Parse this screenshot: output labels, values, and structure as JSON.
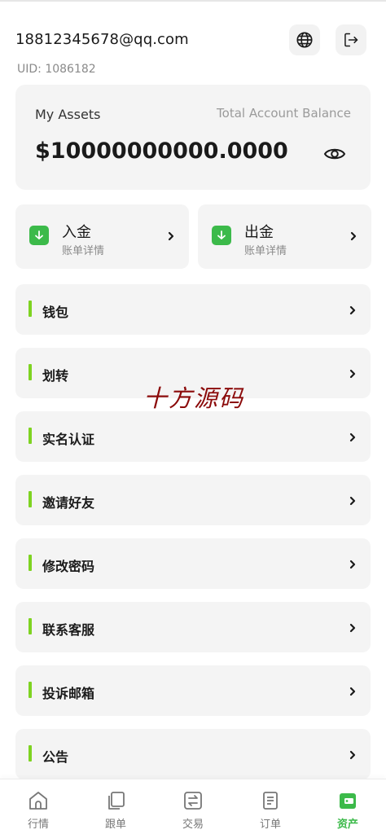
{
  "header": {
    "email": "18812345678@qq.com",
    "uid": "UID: 1086182",
    "globe_icon": "globe-icon",
    "logout_icon": "logout-icon"
  },
  "assets": {
    "label": "My Assets",
    "total_label": "Total Account Balance",
    "balance": "$10000000000.0000",
    "eye_icon": "eye-icon"
  },
  "funds": [
    {
      "title": "入金",
      "subtitle": "账单详情",
      "icon": "download-icon"
    },
    {
      "title": "出金",
      "subtitle": "账单详情",
      "icon": "download-icon"
    }
  ],
  "menu": [
    {
      "label": "钱包"
    },
    {
      "label": "划转"
    },
    {
      "label": "实名认证"
    },
    {
      "label": "邀请好友"
    },
    {
      "label": "修改密码"
    },
    {
      "label": "联系客服"
    },
    {
      "label": "投诉邮箱"
    },
    {
      "label": "公告"
    }
  ],
  "watermark": "十方源码",
  "tabs": [
    {
      "label": "行情",
      "icon": "home-icon"
    },
    {
      "label": "跟单",
      "icon": "copy-icon"
    },
    {
      "label": "交易",
      "icon": "exchange-icon"
    },
    {
      "label": "订单",
      "icon": "document-icon"
    },
    {
      "label": "资产",
      "icon": "wallet-icon",
      "active": true
    }
  ],
  "colors": {
    "accent_green": "#3cba4a",
    "bar_green": "#7ed321",
    "card_bg": "#f4f4f4",
    "watermark_red": "#8b0a0a"
  }
}
